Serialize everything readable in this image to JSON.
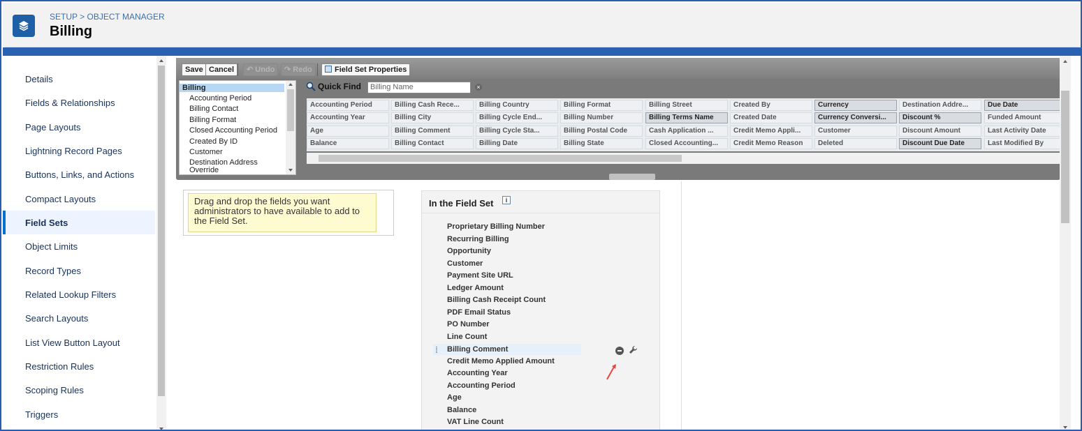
{
  "header": {
    "breadcrumb_setup": "SETUP",
    "breadcrumb_sep": ">",
    "breadcrumb_object_manager": "OBJECT MANAGER",
    "title": "Billing",
    "icon": "layers-icon"
  },
  "sidebar": {
    "items": [
      {
        "label": "Details"
      },
      {
        "label": "Fields & Relationships"
      },
      {
        "label": "Page Layouts"
      },
      {
        "label": "Lightning Record Pages"
      },
      {
        "label": "Buttons, Links, and Actions"
      },
      {
        "label": "Compact Layouts"
      },
      {
        "label": "Field Sets",
        "active": true
      },
      {
        "label": "Object Limits"
      },
      {
        "label": "Record Types"
      },
      {
        "label": "Related Lookup Filters"
      },
      {
        "label": "Search Layouts"
      },
      {
        "label": "List View Button Layout"
      },
      {
        "label": "Restriction Rules"
      },
      {
        "label": "Scoping Rules"
      },
      {
        "label": "Triggers"
      }
    ]
  },
  "toolbar": {
    "save": "Save",
    "cancel": "Cancel",
    "undo": "Undo",
    "redo": "Redo",
    "field_set_properties": "Field Set Properties"
  },
  "object_list": [
    "Billing",
    "Accounting Period",
    "Billing Contact",
    "Billing Format",
    "Closed Accounting Period",
    "Created By ID",
    "Customer",
    "Destination Address",
    "Override"
  ],
  "quick_find": {
    "label": "Quick Find",
    "value": "Billing Name"
  },
  "field_grid": {
    "columns": [
      [
        "Accounting Period",
        "Accounting Year",
        "Age",
        "Balance"
      ],
      [
        "Billing Cash Rece...",
        "Billing City",
        "Billing Comment",
        "Billing Contact"
      ],
      [
        "Billing Country",
        "Billing Cycle End...",
        "Billing Cycle Sta...",
        "Billing Date"
      ],
      [
        "Billing Format",
        "Billing Number",
        "Billing Postal Code",
        "Billing State"
      ],
      [
        "Billing Street",
        "Billing Terms Name",
        "Cash Application ...",
        "Closed Accounting..."
      ],
      [
        "Created By",
        "Created Date",
        "Credit Memo Appli...",
        "Credit Memo Reason"
      ],
      [
        "Currency",
        "Currency Conversi...",
        "Customer",
        "Deleted"
      ],
      [
        "Destination Addre...",
        "Discount %",
        "Discount Amount",
        "Discount Due Date"
      ],
      [
        "Due Date",
        "Funded Amount",
        "Last Activity Date",
        "Last Modified By"
      ]
    ]
  },
  "hint": {
    "text": "Drag and drop the fields you want administrators to have available to add to the Field Set."
  },
  "field_set": {
    "title": "In the Field Set",
    "info": "i",
    "items": [
      "Proprietary Billing Number",
      "Recurring Billing",
      "Opportunity",
      "Customer",
      "Payment Site URL",
      "Ledger Amount",
      "Billing Cash Receipt Count",
      "PDF Email Status",
      "PO Number",
      "Line Count",
      "Billing Comment",
      "Credit Memo Applied Amount",
      "Accounting Year",
      "Accounting Period",
      "Age",
      "Balance",
      "VAT Line Count"
    ]
  },
  "colors": {
    "accent": "#0070d2",
    "header_band": "#2a61b0",
    "annotation_arrow": "#e8453c"
  }
}
